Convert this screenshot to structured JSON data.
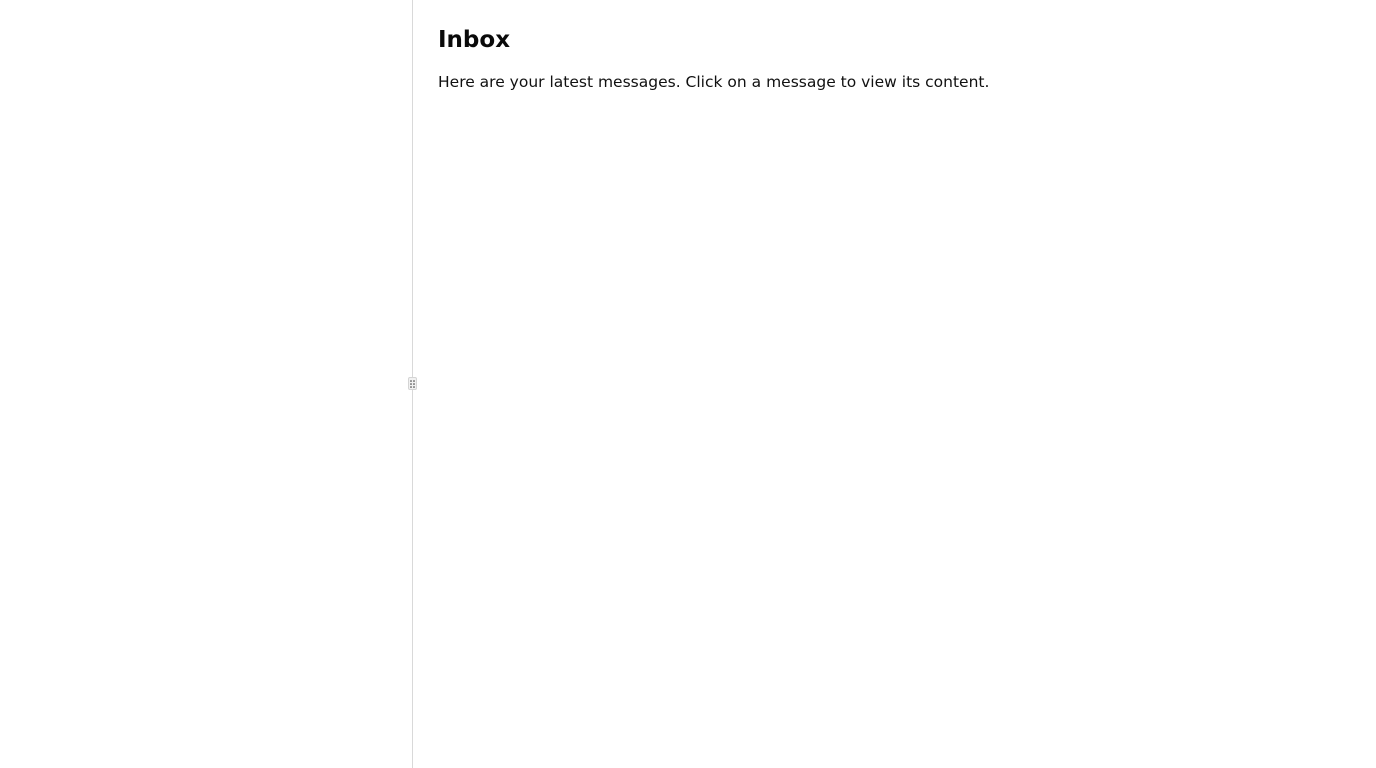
{
  "sidebar": {},
  "main": {
    "title": "Inbox",
    "description": "Here are your latest messages. Click on a message to view its content."
  },
  "colors": {
    "background": "#ffffff",
    "divider": "#d9d9d9",
    "text": "#0a0a0a"
  },
  "icons": {
    "resize_handle": "grip-vertical-icon"
  }
}
